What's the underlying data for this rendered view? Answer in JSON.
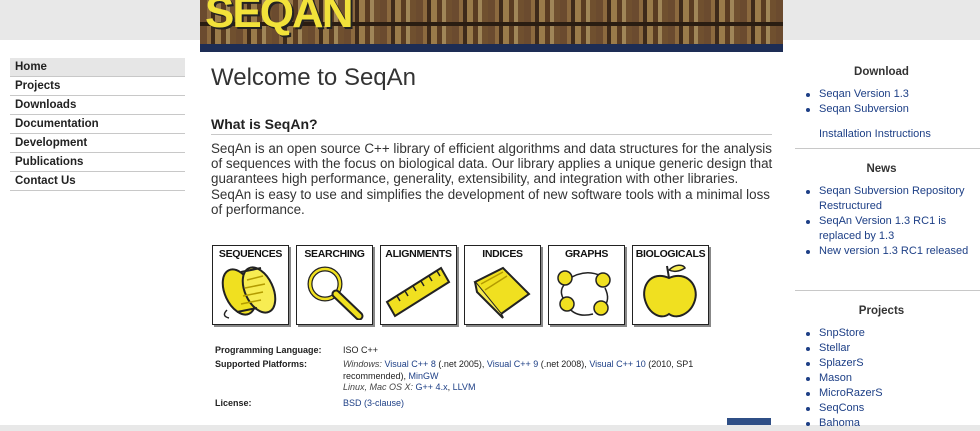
{
  "banner": {
    "logo_text": "SEQAN"
  },
  "nav": {
    "items": [
      {
        "label": "Home",
        "active": true
      },
      {
        "label": "Projects"
      },
      {
        "label": "Downloads"
      },
      {
        "label": "Documentation"
      },
      {
        "label": "Development"
      },
      {
        "label": "Publications"
      },
      {
        "label": "Contact Us"
      }
    ]
  },
  "main": {
    "title": "Welcome to SeqAn",
    "section_title": "What is SeqAn?",
    "intro": "SeqAn is an open source C++ library of efficient algorithms and data structures for the analysis of sequences with the focus on biological data. Our library applies a unique generic design that guarantees high performance, generality, extensibility, and integration with other libraries. SeqAn is easy to use and simplifies the development of new software tools with a minimal loss of performance.",
    "icons": [
      {
        "label": "SEQUENCES",
        "name": "sequences-icon"
      },
      {
        "label": "SEARCHING",
        "name": "magnifier-icon"
      },
      {
        "label": "ALIGNMENTS",
        "name": "ruler-icon"
      },
      {
        "label": "INDICES",
        "name": "index-book-icon"
      },
      {
        "label": "GRAPHS",
        "name": "graph-icon"
      },
      {
        "label": "BIOLOGICALS",
        "name": "apple-icon"
      }
    ],
    "meta": {
      "lang_label": "Programming Language:",
      "lang_value": "ISO C++",
      "platforms_label": "Supported Platforms:",
      "windows": "Windows:",
      "vc8": "Visual C++ 8",
      "vc8_note": "(.net 2005),",
      "vc9": "Visual C++ 9",
      "vc9_note": "(.net 2008),",
      "vc10": "Visual C++ 10",
      "vc10_note": "(2010, SP1",
      "recommended": "recommended),",
      "mingw": "MinGW",
      "unix": "Linux, Mac OS X:",
      "gpp": "G++ 4.x",
      "llvm": "LLVM",
      "license_label": "License:",
      "license_value": "BSD (3-clause)"
    }
  },
  "right": {
    "download_title": "Download",
    "download_items": [
      "Seqan Version 1.3",
      "Seqan Subversion"
    ],
    "install_link": "Installation Instructions",
    "news_title": "News",
    "news_items": [
      "Seqan Subversion Repository Restructured",
      "SeqAn Version 1.3 RC1 is replaced by 1.3",
      "New version 1.3 RC1 released"
    ],
    "projects_title": "Projects",
    "project_items": [
      "SnpStore",
      "Stellar",
      "SplazerS",
      "Mason",
      "MicroRazerS",
      "SeqCons",
      "Bahoma"
    ]
  }
}
